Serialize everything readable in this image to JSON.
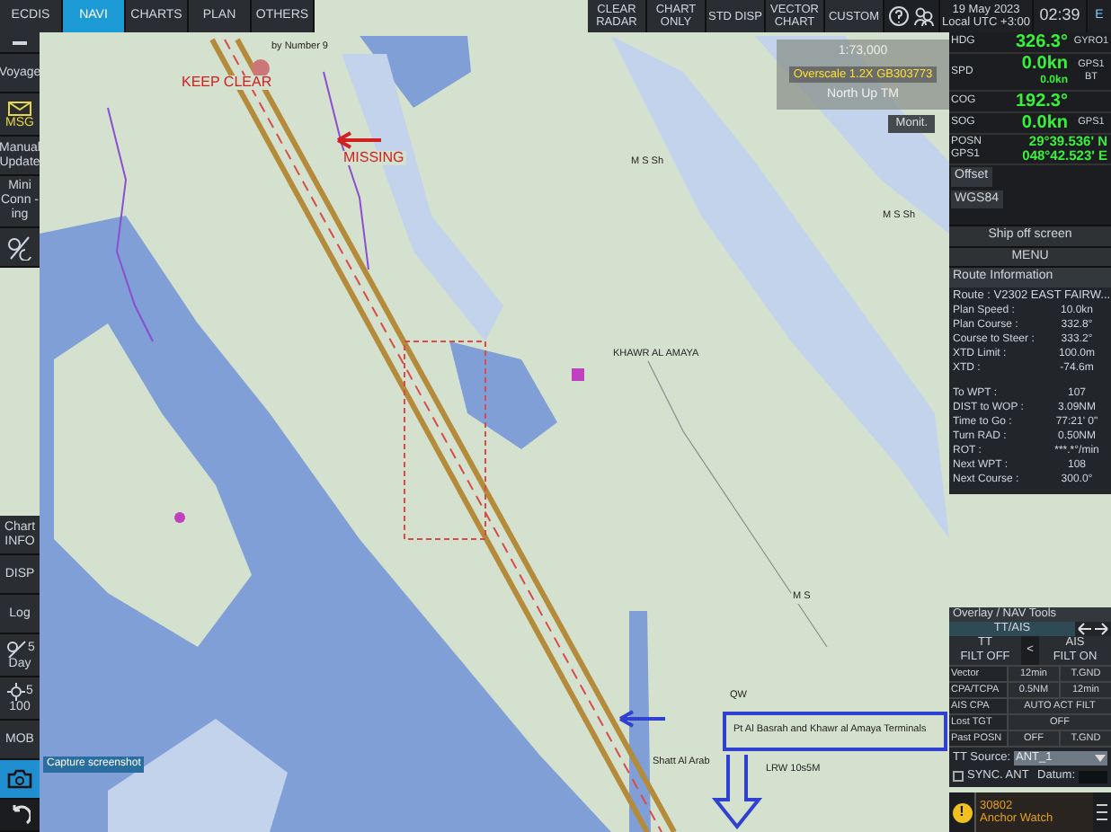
{
  "top_tabs": [
    {
      "label": "ECDIS",
      "selected": false
    },
    {
      "label": "NAVI",
      "selected": true
    },
    {
      "label": "CHARTS",
      "selected": false
    },
    {
      "label": "PLAN",
      "selected": false
    },
    {
      "label": "OTHERS",
      "selected": false
    }
  ],
  "display_buttons": [
    "CLEAR RADAR",
    "CHART ONLY",
    "STD DISP",
    "VECTOR CHART",
    "CUSTOM"
  ],
  "clock": {
    "date": "19 May 2023",
    "zone": "Local UTC +3:00",
    "time": "02:39",
    "mode": "E"
  },
  "left_top": [
    {
      "kind": "back"
    },
    {
      "kind": "text",
      "label": "Voyage"
    },
    {
      "kind": "msg",
      "label": "MSG"
    },
    {
      "kind": "text",
      "label": "Manual Update"
    },
    {
      "kind": "text",
      "label": "Mini Conn -ing"
    },
    {
      "kind": "brightness"
    }
  ],
  "left_bottom": [
    {
      "kind": "text",
      "label": "Chart INFO"
    },
    {
      "kind": "text",
      "label": "DISP"
    },
    {
      "kind": "text",
      "label": "Log"
    },
    {
      "kind": "day",
      "label": "Day",
      "value": "5"
    },
    {
      "kind": "sun",
      "label": "100",
      "value": "5"
    },
    {
      "kind": "text",
      "label": "MOB"
    },
    {
      "kind": "camera"
    },
    {
      "kind": "undo"
    }
  ],
  "sensors": [
    {
      "label": "HDG",
      "value": "326.3°",
      "source": "GYRO1"
    },
    {
      "label": "SPD",
      "value": "0.0kn",
      "sub": "0.0kn",
      "source": "GPS1 BT"
    },
    {
      "label": "COG",
      "value": "192.3°"
    },
    {
      "label": "SOG",
      "value": "0.0kn",
      "source": "GPS1"
    }
  ],
  "position": {
    "label": "POSN",
    "source": "GPS1",
    "lat": "29°39.536' N",
    "lon": "048°42.523' E"
  },
  "offset": "Offset",
  "datum": "WGS84",
  "ship_off_screen": "Ship off screen",
  "menu": "MENU",
  "route_info": {
    "title": "Route Information",
    "route": "Route : V2302 EAST FAIRW...",
    "groups": [
      [
        {
          "label": "Plan Speed :",
          "value": "10.0kn"
        },
        {
          "label": "Plan Course :",
          "value": "332.8°"
        },
        {
          "label": "Course to Steer :",
          "value": "333.2°"
        },
        {
          "label": "XTD Limit :",
          "value": "100.0m"
        },
        {
          "label": "XTD :",
          "value": "-74.6m"
        }
      ],
      [
        {
          "label": "To WPT :",
          "value": "107"
        },
        {
          "label": "DIST to WOP :",
          "value": "3.09NM"
        },
        {
          "label": "Time to Go :",
          "value": "77:21' 0\""
        },
        {
          "label": "Turn RAD :",
          "value": "0.50NM"
        },
        {
          "label": "ROT :",
          "value": "***.*°/min"
        },
        {
          "label": "Next WPT :",
          "value": "108"
        },
        {
          "label": "Next Course :",
          "value": "300.0°"
        }
      ]
    ]
  },
  "overlay_tools": {
    "title": "Overlay / NAV Tools",
    "tab": "TT/AIS",
    "tt": {
      "label": "TT",
      "state": "FILT OFF"
    },
    "toggle": "<",
    "ais": {
      "label": "AIS",
      "state": "FILT ON"
    },
    "rows": [
      {
        "label": "Vector",
        "cells": [
          "12min",
          "T.GND"
        ]
      },
      {
        "label": "CPA/TCPA",
        "cells": [
          "0.5NM",
          "12min"
        ]
      },
      {
        "label": "AIS CPA",
        "cells": [
          "AUTO ACT FILT"
        ]
      },
      {
        "label": "Lost TGT",
        "cells": [
          "OFF"
        ]
      },
      {
        "label": "Past POSN",
        "cells": [
          "OFF",
          "T.GND"
        ]
      }
    ],
    "tt_source_label": "TT Source:",
    "tt_source": "ANT_1",
    "sync": {
      "label": "SYNC. ANT",
      "checked": false
    },
    "datum_label": "Datum:"
  },
  "alert": {
    "symbol": "!",
    "code": "30802",
    "text": "Anchor Watch"
  },
  "chart_overlay": {
    "scale": "1:73,000",
    "overscale": "Overscale 1.2X GB303773",
    "orientation": "North Up TM",
    "monitor": "Monit."
  },
  "tooltip": "Capture screenshot",
  "map_labels": [
    {
      "text": "by Number 9",
      "kind": "black"
    },
    {
      "text": "KEEP CLEAR",
      "kind": "red"
    },
    {
      "text": "MISSING",
      "kind": "red"
    },
    {
      "text": "M S Sh",
      "kind": "black"
    },
    {
      "text": "M S Sh",
      "kind": "black"
    },
    {
      "text": "KHAWR AL AMAYA",
      "kind": "black"
    },
    {
      "text": "M S",
      "kind": "black"
    },
    {
      "text": "QW",
      "kind": "black"
    },
    {
      "text": "Pt Al Basrah and Khawr al Amaya Terminals",
      "kind": "black"
    },
    {
      "text": "Shatt Al Arab",
      "kind": "black"
    },
    {
      "text": "LRW 10s5M",
      "kind": "black"
    }
  ]
}
